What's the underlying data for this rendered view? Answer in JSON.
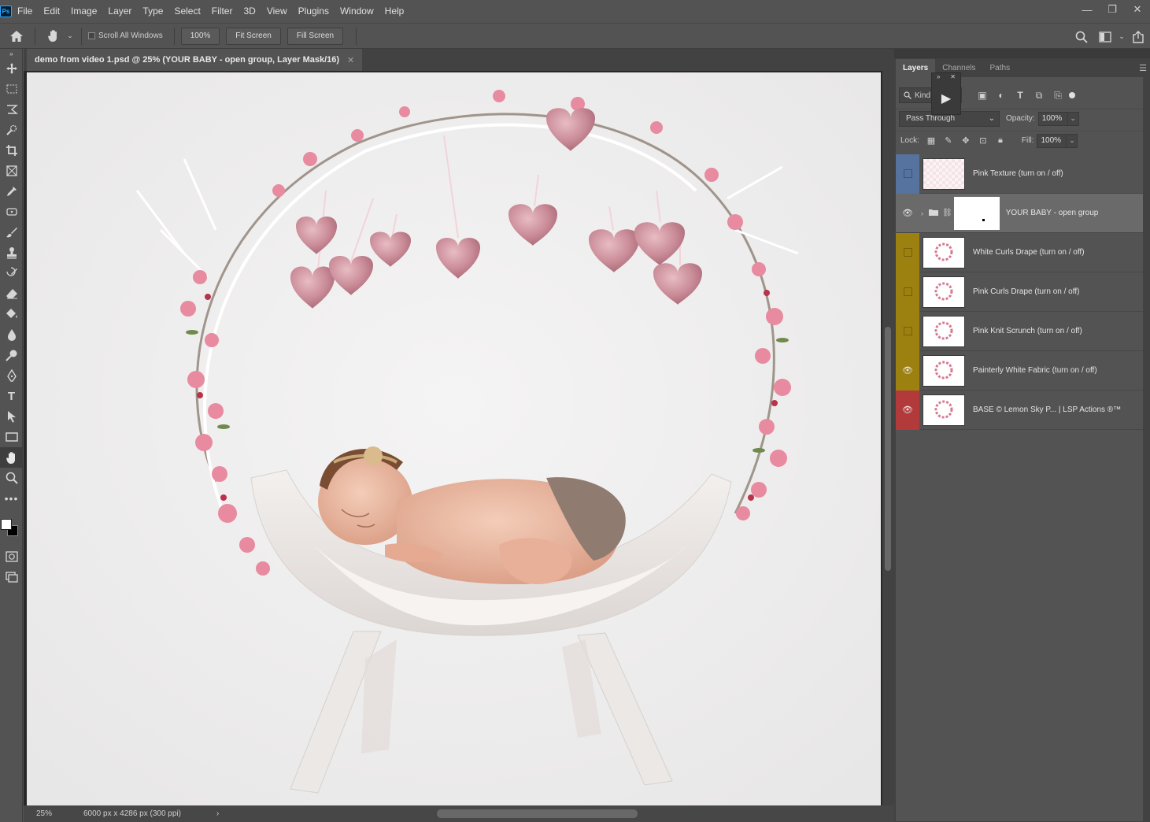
{
  "app": {
    "logo": "Ps",
    "menu": [
      "File",
      "Edit",
      "Image",
      "Layer",
      "Type",
      "Select",
      "Filter",
      "3D",
      "View",
      "Plugins",
      "Window",
      "Help"
    ],
    "window_controls": {
      "minimize": "—",
      "restore": "❐",
      "close": "✕"
    }
  },
  "options_bar": {
    "scroll_all_label": "Scroll All Windows",
    "zoom_value": "100%",
    "fit_screen_label": "Fit Screen",
    "fill_screen_label": "Fill Screen"
  },
  "document": {
    "tab_title": "demo from video 1.psd @ 25% (YOUR BABY - open group, Layer Mask/16)",
    "tab_close": "✕"
  },
  "status": {
    "zoom": "25%",
    "doc_info": "6000 px x 4286 px (300 ppi)",
    "arrow": "›"
  },
  "panel": {
    "tabs": [
      "Layers",
      "Channels",
      "Paths"
    ],
    "filter_kind": "Kind",
    "blend_mode": "Pass Through",
    "opacity_label": "Opacity:",
    "opacity_value": "100%",
    "lock_label": "Lock:",
    "fill_label": "Fill:",
    "fill_value": "100%"
  },
  "layers": [
    {
      "name": "Pink Texture (turn on / off)",
      "color": "#56729e",
      "visible": false
    },
    {
      "name": "YOUR BABY - open group",
      "color": "#535353",
      "visible": true,
      "group": true
    },
    {
      "name": "White Curls Drape (turn on / off)",
      "color": "#9c8110",
      "visible": false
    },
    {
      "name": "Pink Curls Drape (turn on / off)",
      "color": "#9c8110",
      "visible": false
    },
    {
      "name": "Pink Knit Scrunch (turn on / off)",
      "color": "#9c8110",
      "visible": false
    },
    {
      "name": "Painterly White Fabric (turn on / off)",
      "color": "#9c8110",
      "visible": true
    },
    {
      "name": "BASE © Lemon Sky P... | LSP Actions ®™",
      "color": "#b33a3a",
      "visible": true
    }
  ],
  "icons": {
    "home": "home-icon",
    "hand": "hand-icon",
    "search": "search-icon",
    "eye": "eye-icon"
  }
}
